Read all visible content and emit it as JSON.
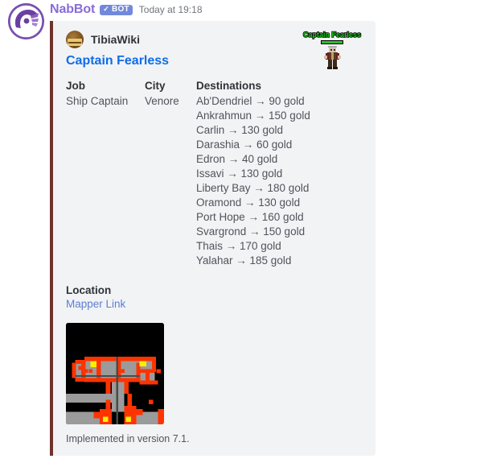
{
  "message": {
    "username": "NabBot",
    "bot_badge": "BOT",
    "bot_check": "✓",
    "timestamp": "Today at 19:18",
    "avatar_icon": "nabbot-logo-icon"
  },
  "embed": {
    "accent_color": "#70322c",
    "background_color": "#f2f3f5",
    "author": {
      "name": "TibiaWiki",
      "icon": "tibiawiki-icon"
    },
    "title": "Captain Fearless",
    "title_color": "#0f6ce8",
    "fields": [
      {
        "name": "Job",
        "value": "Ship Captain"
      },
      {
        "name": "City",
        "value": "Venore"
      }
    ],
    "destinations_field": {
      "name": "Destinations",
      "entries": [
        "Ab'Dendriel → 90 gold",
        "Ankrahmun → 150 gold",
        "Carlin → 130 gold",
        "Darashia → 60 gold",
        "Edron → 40 gold",
        "Issavi → 130 gold",
        "Liberty Bay → 180 gold",
        "Oramond → 130 gold",
        "Port Hope → 160 gold",
        "Svargrond → 150 gold",
        "Thais → 170 gold",
        "Yalahar → 185 gold"
      ]
    },
    "location_field": {
      "name": "Location",
      "link_label": "Mapper Link"
    },
    "map_image": {
      "name": "tibia-minimap-image",
      "colors": {
        "background": "#000000",
        "floor": "#9b9b9b",
        "wall": "#ff3300",
        "marker": "#ffee00"
      }
    },
    "thumbnail": {
      "name": "captain-fearless-npc-sprite",
      "nameplate": "Captain Fearless",
      "nameplate_color": "#22cc22",
      "healthbar_color": "#2fbf2f"
    },
    "footer": "Implemented in version 7.1."
  }
}
